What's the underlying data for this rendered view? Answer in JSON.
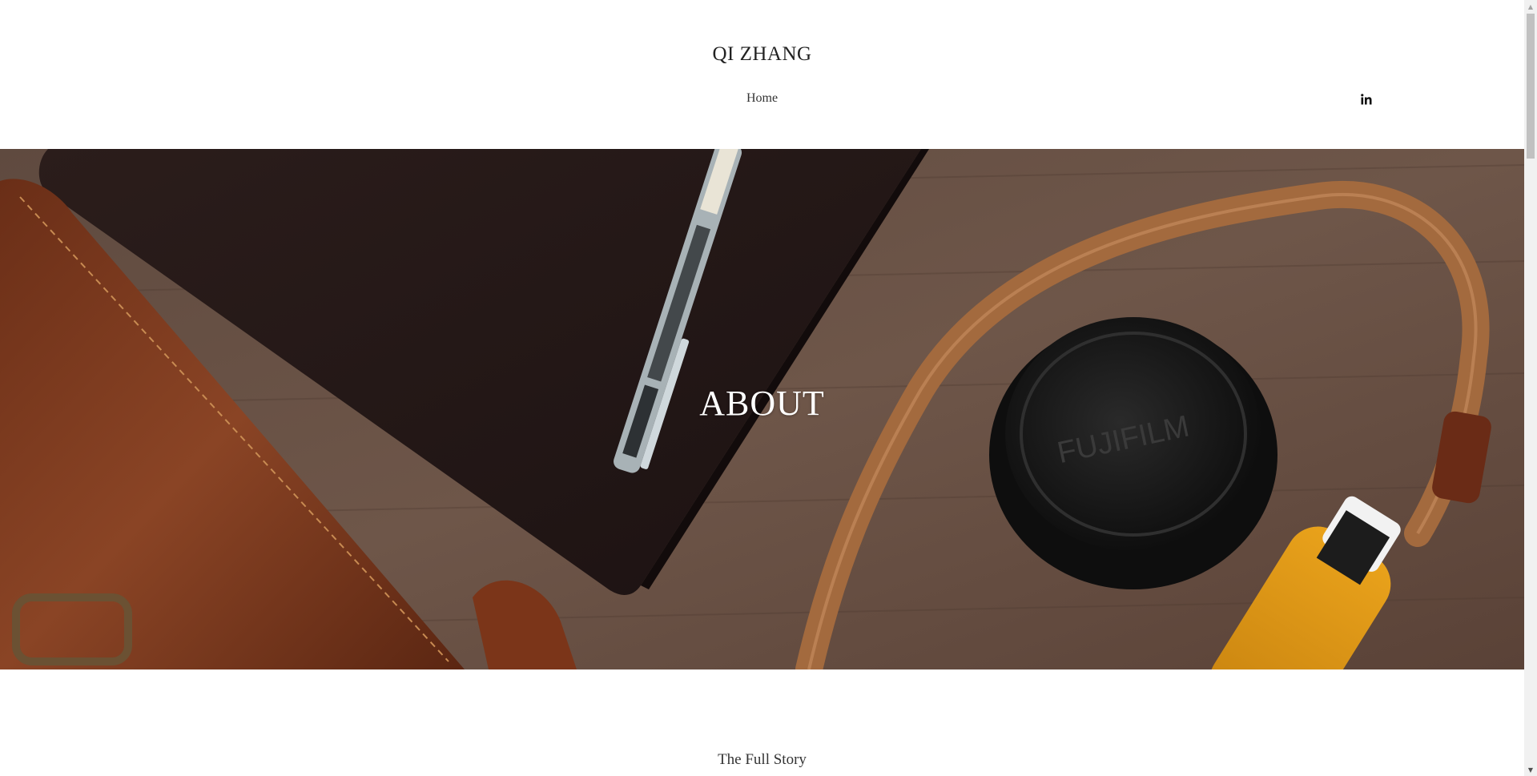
{
  "header": {
    "site_title": "QI ZHANG",
    "nav": [
      {
        "label": "Home"
      }
    ],
    "social_icon": "linkedin-icon"
  },
  "hero": {
    "heading": "ABOUT",
    "image_description_icon": "hero-photo"
  },
  "content": {
    "section_title": "The Full Story"
  },
  "scrollbar": {
    "up_glyph": "▲",
    "down_glyph": "▼"
  },
  "colors": {
    "page_bg": "#ffffff",
    "text": "#333333",
    "hero_text": "#ffffff"
  }
}
